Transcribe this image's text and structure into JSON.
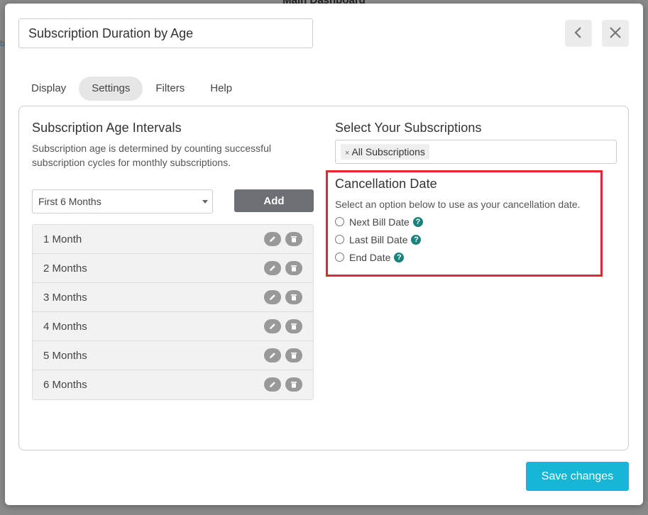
{
  "backdrop": {
    "title": "Main Dashboard",
    "edge_glyph": "b"
  },
  "modal": {
    "title_value": "Subscription Duration by Age",
    "back_icon": "chevron-left-icon",
    "close_icon": "close-icon"
  },
  "tabs": [
    {
      "label": "Display",
      "active": false
    },
    {
      "label": "Settings",
      "active": true
    },
    {
      "label": "Filters",
      "active": false
    },
    {
      "label": "Help",
      "active": false
    }
  ],
  "intervals": {
    "heading": "Subscription Age Intervals",
    "description": "Subscription age is determined by counting successful subscription cycles for monthly subscriptions.",
    "preset_selected": "First 6 Months",
    "add_label": "Add",
    "items": [
      {
        "label": "1 Month"
      },
      {
        "label": "2 Months"
      },
      {
        "label": "3 Months"
      },
      {
        "label": "4 Months"
      },
      {
        "label": "5 Months"
      },
      {
        "label": "6 Months"
      }
    ]
  },
  "subscriptions": {
    "heading": "Select Your Subscriptions",
    "chip_label": "All Subscriptions",
    "chip_remove": "×"
  },
  "cancellation": {
    "heading": "Cancellation Date",
    "description": "Select an option below to use as your cancellation date.",
    "options": [
      {
        "label": "Next Bill Date",
        "help": "?"
      },
      {
        "label": "Last Bill Date",
        "help": "?"
      },
      {
        "label": "End Date",
        "help": "?"
      }
    ],
    "highlight_color": "#e8262b"
  },
  "footer": {
    "save_label": "Save changes"
  },
  "colors": {
    "accent": "#16b6d6",
    "help": "#18837a",
    "add_button": "#6c6f74"
  }
}
